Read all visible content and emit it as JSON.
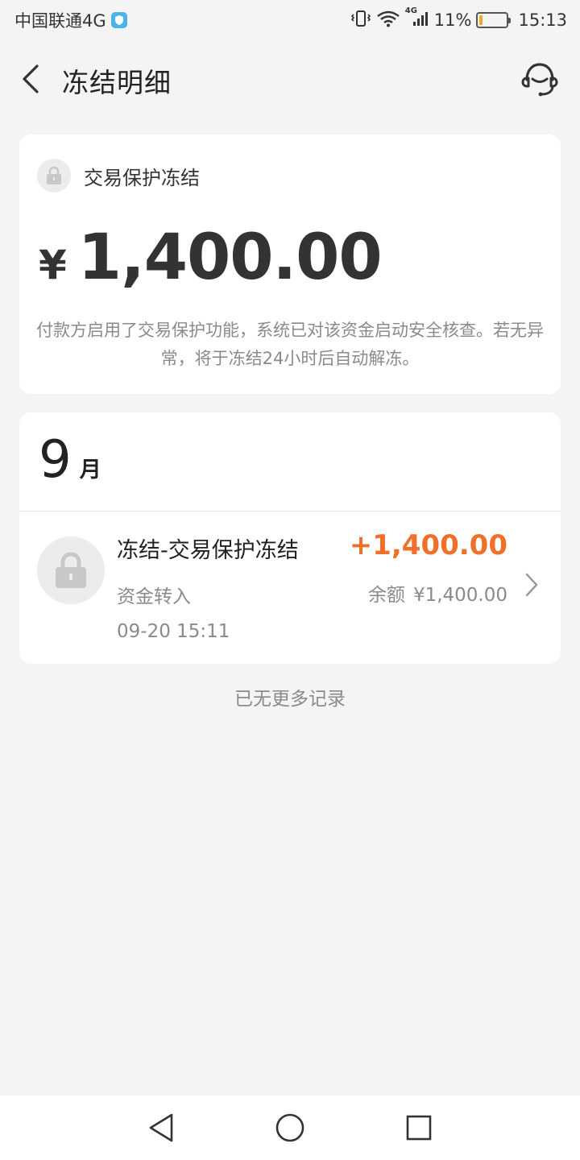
{
  "status_bar": {
    "carrier": "中国联通4G",
    "network_badge": "4G",
    "battery_percent": "11%",
    "battery_level": 0.11,
    "time": "15:13",
    "icons": [
      "shield-icon",
      "vibrate-icon",
      "wifi-icon",
      "signal-icon",
      "battery-icon"
    ]
  },
  "header": {
    "title": "冻结明细",
    "back_icon": "back-arrow-icon",
    "service_icon": "customer-service-icon"
  },
  "freeze_card": {
    "type_label": "交易保护冻结",
    "currency_symbol": "¥",
    "amount": "1,400.00",
    "notice": "付款方启用了交易保护功能，系统已对该资金启动安全核查。若无异常，将于冻结24小时后自动解冻。"
  },
  "records": {
    "month_number": "9",
    "month_unit": "月",
    "items": [
      {
        "title": "冻结-交易保护冻结",
        "subtitle": "资金转入",
        "time": "09-20 15:11",
        "amount": "+1,400.00",
        "balance_label": "余额",
        "balance_value": "¥1,400.00"
      }
    ]
  },
  "footer": {
    "no_more_text": "已无更多记录"
  },
  "colors": {
    "accent_amount": "#f0702a",
    "background": "#f4f4f4",
    "card": "#ffffff"
  }
}
